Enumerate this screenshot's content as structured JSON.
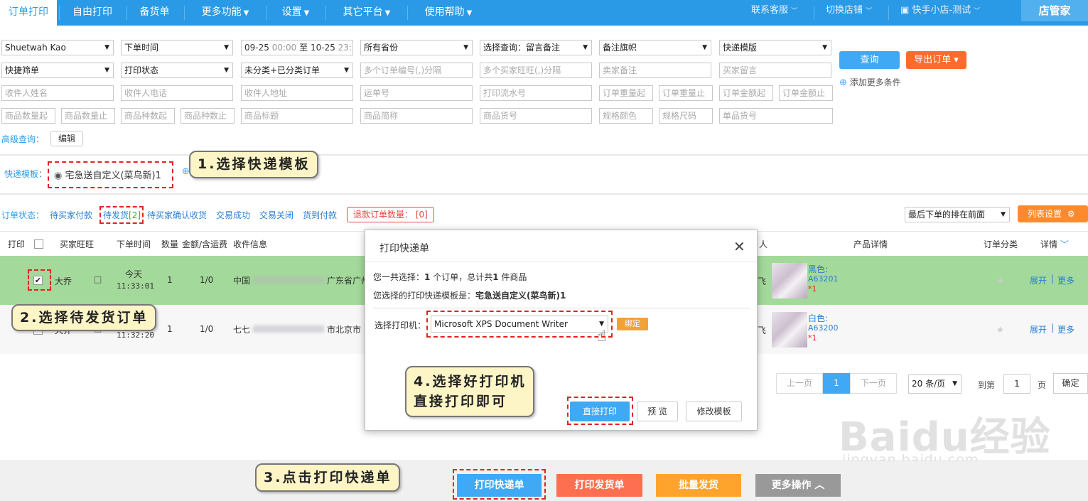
{
  "nav": {
    "items": [
      "订单打印",
      "自由打印",
      "备货单",
      "更多功能",
      "设置",
      "其它平台",
      "使用帮助"
    ],
    "right": [
      "联系客服",
      "切换店铺",
      "快手小店-测试"
    ],
    "brand": "店管家"
  },
  "filters": {
    "row1": [
      "Shuetwah Kao",
      "下单时间",
      "所有省份",
      "选择查询：留言备注",
      "备注旗帜",
      "快递模版"
    ],
    "date_from": "09-25",
    "date_from_time": "00:00",
    "date_sep": "至",
    "date_to": "10-25",
    "date_to_time": "23:59",
    "row2_selects": [
      "快捷筛单",
      "打印状态",
      "未分类+已分类订单"
    ],
    "row2_inputs": [
      "多个订单编号(,)分隔",
      "多个买家旺旺(,)分隔",
      "卖家备注",
      "买家留言"
    ],
    "row3": [
      "收件人姓名",
      "收件人电话",
      "收件人地址",
      "运单号",
      "打印流水号",
      "订单重量起",
      "订单重量止",
      "订单金额起",
      "订单金额止"
    ],
    "row4": [
      "商品数量起",
      "商品数量止",
      "商品种数起",
      "商品种数止",
      "商品标题",
      "商品简称",
      "商品货号",
      "规格颜色",
      "规格尺码",
      "单品货号"
    ],
    "query_button": "查询",
    "export_button": "导出订单 ▾",
    "add_more": "添加更多条件",
    "advanced_label": "高级查询：",
    "edit_button": "编辑"
  },
  "template": {
    "label": "快递模板：",
    "option": "宅急送自定义(菜鸟新)1"
  },
  "status": {
    "label": "订单状态：",
    "tabs": [
      "待买家付款",
      "待发货",
      "待买家确认收货",
      "交易成功",
      "交易关闭",
      "货到付款"
    ],
    "pending_count": "[2]",
    "refund": "退款订单数量：",
    "refund_count": "[0]",
    "sort": "最后下单的排在前面",
    "columns_button": "列表设置"
  },
  "table": {
    "headers": [
      "打印",
      "买家旺旺",
      "下单时间",
      "数量",
      "金额/含运费",
      "收件信息",
      "人",
      "产品详情",
      "订单分类",
      "详情"
    ],
    "rows": [
      {
        "buyer": "大乔",
        "date": "今天",
        "time": "11:33:01",
        "qty": "1",
        "amount": "1/0",
        "addr_a": "中国",
        "addr_b": "广东省广州",
        "color": "黑色:",
        "sku": "A63201",
        "count": "*1",
        "side": "飞",
        "expand": "展开",
        "more": "更多"
      },
      {
        "buyer": "大乔",
        "date": "今天",
        "time": "11:32:20",
        "qty": "1",
        "amount": "1/0",
        "addr_a": "七七",
        "addr_b": "市北京市",
        "color": "白色:",
        "sku": "A63200",
        "count": "*1",
        "side": "飞",
        "expand": "展开",
        "more": "更多"
      }
    ]
  },
  "modal": {
    "title": "打印快递单",
    "line1_a": "您一共选择：",
    "line1_b": "1",
    "line1_c": " 个订单，总计共",
    "line1_d": "1",
    "line1_e": " 件商品",
    "line2_a": "您选择的打印快递模板是：",
    "line2_b": "宅急送自定义(菜鸟新)1",
    "printer_label": "选择打印机：",
    "printer": "Microsoft XPS Document Writer",
    "bind": "绑定",
    "print_direct": "直接打印",
    "preview": "预 览",
    "edit_template": "修改模板"
  },
  "pager": {
    "prev": "上一页",
    "current": "1",
    "next": "下一页",
    "size": "20 条/页",
    "goto": "到第",
    "page_val": "1",
    "page_unit": "页",
    "confirm": "确定"
  },
  "bottom": {
    "print_express": "打印快递单",
    "print_delivery": "打印发货单",
    "batch_ship": "批量发货",
    "more_ops": "更多操作 ︿"
  },
  "callouts": [
    "1.选择快递模板",
    "2.选择待发货订单",
    "3.点击打印快递单",
    "4.选择好打印机",
    "直接打印即可"
  ],
  "watermark": {
    "logo": "Baidu经验",
    "url": "jingyan.baidu.com"
  }
}
